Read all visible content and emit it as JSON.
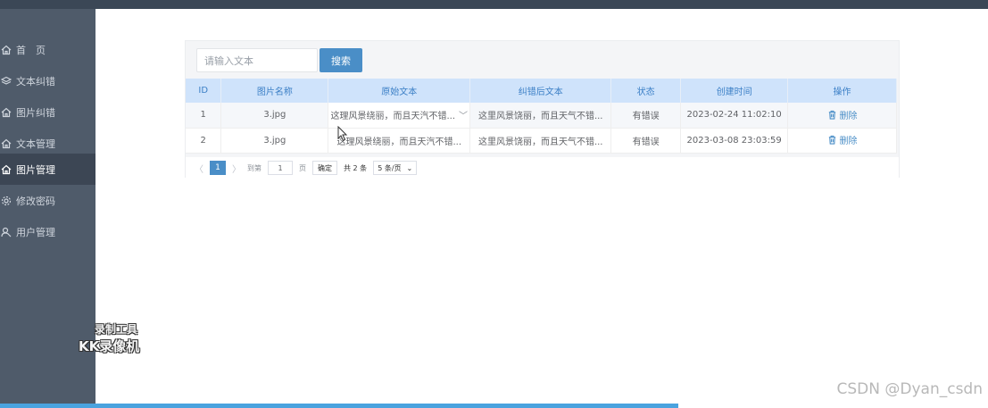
{
  "sidebar": {
    "items": [
      {
        "label": "首　页",
        "icon": "home-icon"
      },
      {
        "label": "文本纠错",
        "icon": "layers-icon"
      },
      {
        "label": "图片纠错",
        "icon": "home-icon"
      },
      {
        "label": "文本管理",
        "icon": "home-icon"
      },
      {
        "label": "图片管理",
        "icon": "home-icon",
        "active": true
      },
      {
        "label": "修改密码",
        "icon": "gear-icon"
      },
      {
        "label": "用户管理",
        "icon": "user-search-icon"
      }
    ]
  },
  "search": {
    "placeholder": "请输入文本",
    "button_label": "搜索"
  },
  "table": {
    "headers": [
      "ID",
      "图片名称",
      "原始文本",
      "纠错后文本",
      "状态",
      "创建时间",
      "操作"
    ],
    "rows": [
      {
        "id": "1",
        "name": "3.jpg",
        "original": "这理风景绕丽，而且天汽不错...",
        "corrected": "这里风景饶丽，而且天气不错...",
        "status": "有错误",
        "created": "2023-02-24 11:02:10",
        "action": "删除"
      },
      {
        "id": "2",
        "name": "3.jpg",
        "original": "这理风景绕丽，而且天汽不错...",
        "corrected": "这里风景饶丽，而且天气不错...",
        "status": "有错误",
        "created": "2023-03-08 23:03:59",
        "action": "删除"
      }
    ]
  },
  "pagination": {
    "current": "1",
    "goto_label": "到第",
    "goto_value": "1",
    "page_unit": "页",
    "confirm": "确定",
    "total": "共 2 条",
    "page_size": "5 条/页"
  },
  "watermarks": {
    "recorder_line1": "录制工具",
    "recorder_line2": "KK录像机",
    "csdn": "CSDN @Dyan_csdn"
  },
  "colors": {
    "sidebar": "#4f5b6a",
    "sidebar_active": "#3c4654",
    "accent": "#4a8ec7",
    "table_header": "#cfe3fb"
  }
}
